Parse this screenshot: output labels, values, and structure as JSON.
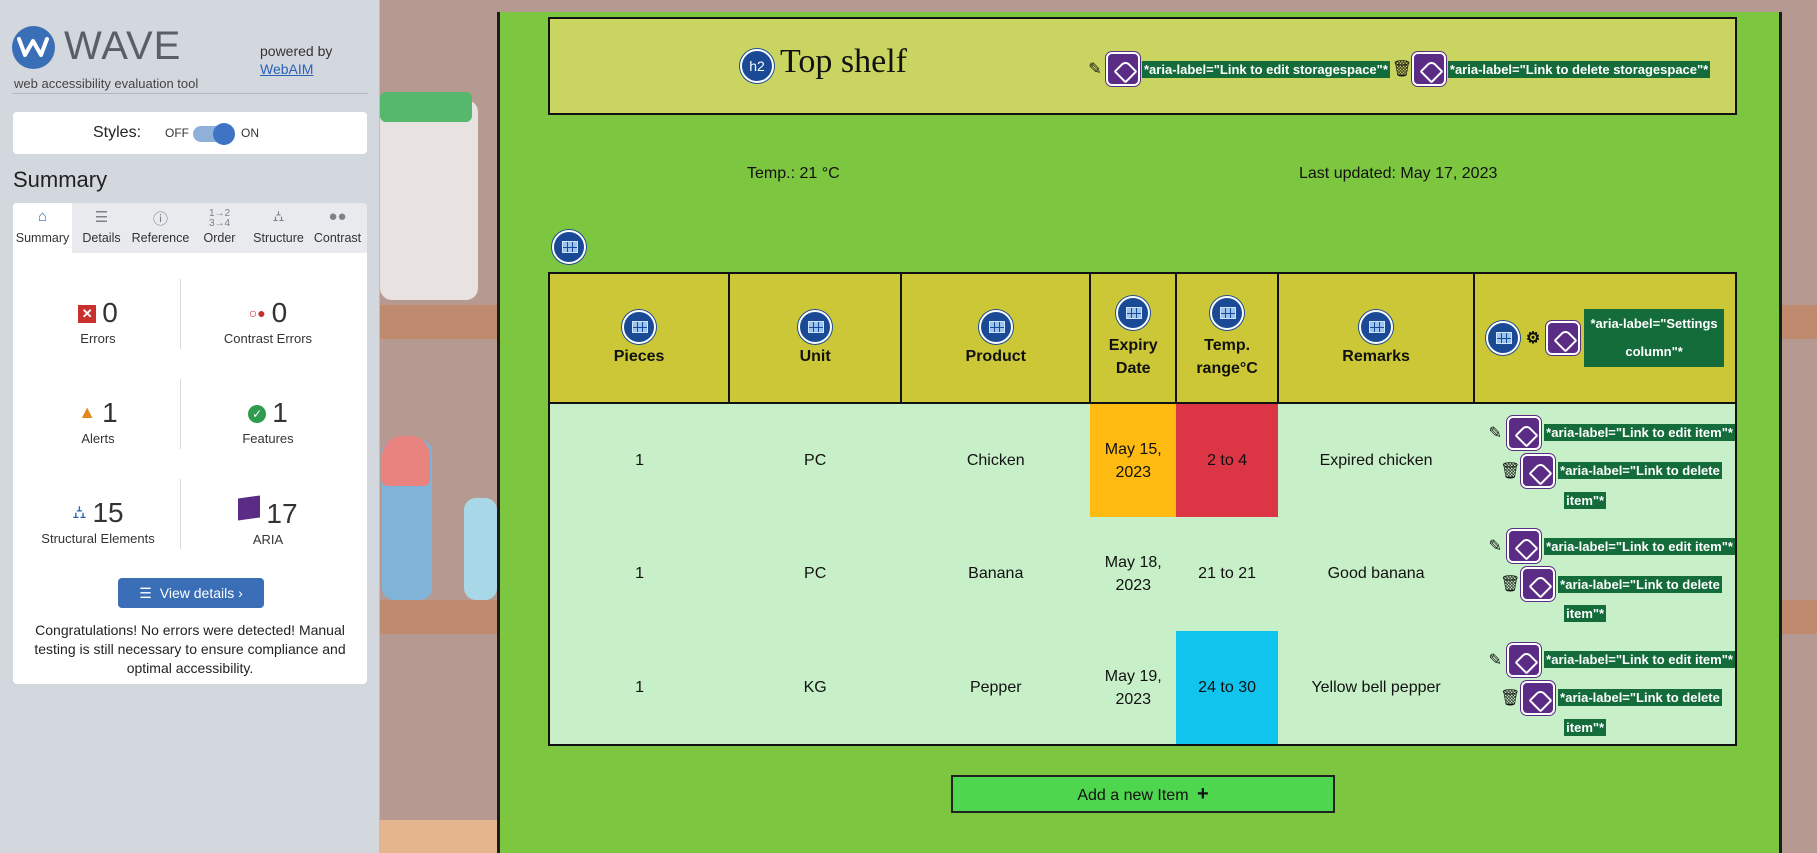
{
  "wave": {
    "name": "WAVE",
    "tagline": "web accessibility evaluation tool",
    "powered_by": "powered by",
    "webaim": "WebAIM",
    "styles_label": "Styles:",
    "styles_off": "OFF",
    "styles_on": "ON",
    "summary_title": "Summary",
    "tabs": [
      {
        "label": "Summary",
        "icon": "home-icon"
      },
      {
        "label": "Details",
        "icon": "list-icon"
      },
      {
        "label": "Reference",
        "icon": "info-icon"
      },
      {
        "label": "Order",
        "icon": "order-icon"
      },
      {
        "label": "Structure",
        "icon": "structure-icon"
      },
      {
        "label": "Contrast",
        "icon": "contrast-icon"
      }
    ],
    "stats": {
      "errors": {
        "value": "0",
        "label": "Errors"
      },
      "contrast_errors": {
        "value": "0",
        "label": "Contrast Errors"
      },
      "alerts": {
        "value": "1",
        "label": "Alerts"
      },
      "features": {
        "value": "1",
        "label": "Features"
      },
      "structural": {
        "value": "15",
        "label": "Structural Elements"
      },
      "aria": {
        "value": "17",
        "label": "ARIA"
      }
    },
    "view_details": "View details ›",
    "congrats": "Congratulations! No errors were detected! Manual testing is still necessary to ensure compliance and optimal accessibility."
  },
  "shelf": {
    "heading_badge": "h2",
    "title": "Top shelf",
    "edit_aria": "*aria-label=\"Link to edit storagespace\"*",
    "delete_aria": "*aria-label=\"Link to delete storagespace\"*",
    "temp": "Temp.: 21 °C",
    "last_updated": "Last updated: May 17, 2023"
  },
  "table": {
    "headers": [
      "Pieces",
      "Unit",
      "Product",
      "Expiry Date",
      "Temp. range°C",
      "Remarks"
    ],
    "settings_aria": "*aria-label=\"Settings column\"*",
    "edit_item_aria": "*aria-label=\"Link to edit item\"*",
    "delete_item_aria_1": "*aria-label=\"Link to delete",
    "delete_item_aria_2": "item\"*",
    "rows": [
      {
        "pieces": "1",
        "unit": "PC",
        "product": "Chicken",
        "expiry": "May 15, 2023",
        "temp": "2 to 4",
        "remarks": "Expired chicken"
      },
      {
        "pieces": "1",
        "unit": "PC",
        "product": "Banana",
        "expiry": "May 18, 2023",
        "temp": "21 to 21",
        "remarks": "Good banana"
      },
      {
        "pieces": "1",
        "unit": "KG",
        "product": "Pepper",
        "expiry": "May 19, 2023",
        "temp": "24 to 30",
        "remarks": "Yellow bell pepper"
      }
    ]
  },
  "add_item": "Add a new Item",
  "colors": {
    "app_green": "#7dc63f",
    "header_yellow": "#cad561",
    "row_green": "#c8f0c8",
    "expiry_warning": "#ffbb11",
    "temp_alert": "#dc3545",
    "temp_high": "#11c4ee",
    "wave_blue": "#3a6fb7"
  }
}
